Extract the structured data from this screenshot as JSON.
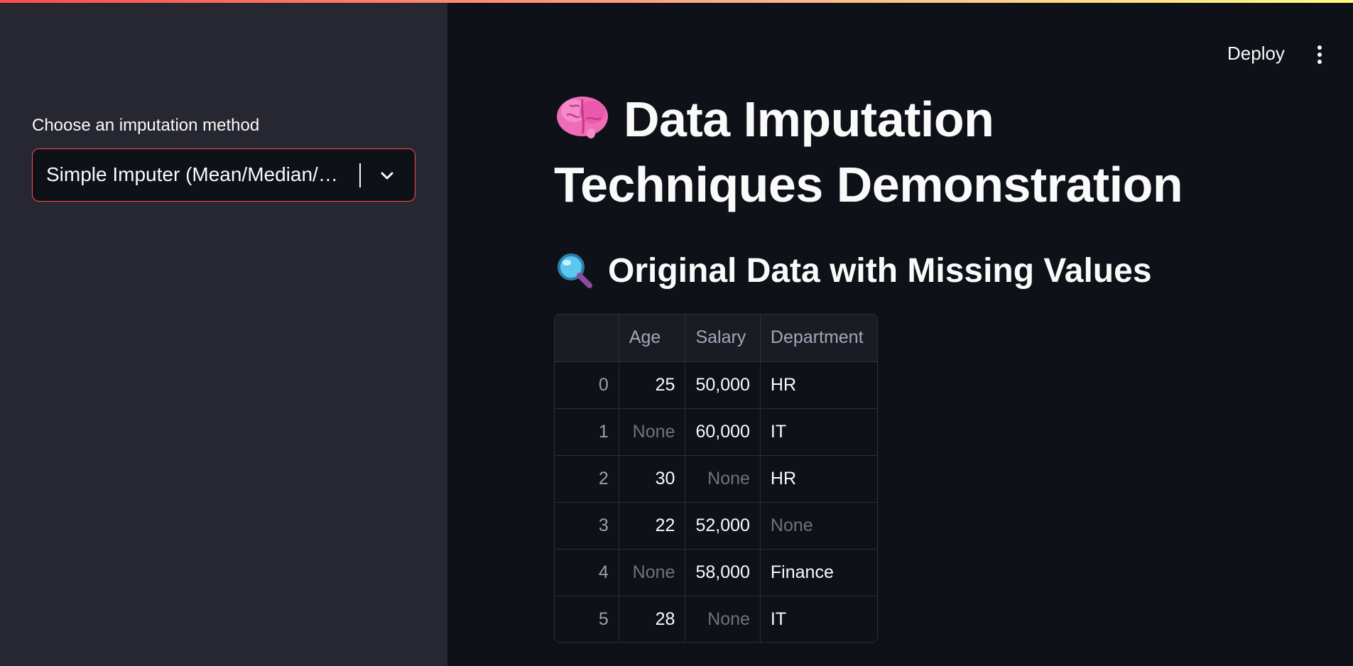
{
  "sidebar": {
    "label": "Choose an imputation method",
    "select_value": "Simple Imputer (Mean/Median/…"
  },
  "header": {
    "deploy_label": "Deploy",
    "menu_icon": "kebab-menu-icon"
  },
  "main": {
    "title": "Data Imputation Techniques Demonstration",
    "title_icon": "brain-icon",
    "subtitle": "Original Data with Missing Values",
    "subtitle_icon": "magnifier-icon",
    "table": {
      "columns": [
        "",
        "Age",
        "Salary",
        "Department"
      ],
      "rows": [
        [
          "0",
          "25",
          "50,000",
          "HR"
        ],
        [
          "1",
          "None",
          "60,000",
          "IT"
        ],
        [
          "2",
          "30",
          "None",
          "HR"
        ],
        [
          "3",
          "22",
          "52,000",
          "None"
        ],
        [
          "4",
          "None",
          "58,000",
          "Finance"
        ],
        [
          "5",
          "28",
          "None",
          "IT"
        ]
      ]
    }
  },
  "colors": {
    "accent": "#ff4b4b",
    "sidebar_bg": "#262730",
    "main_bg": "#0e1117",
    "missing_text": "#6e737d"
  }
}
